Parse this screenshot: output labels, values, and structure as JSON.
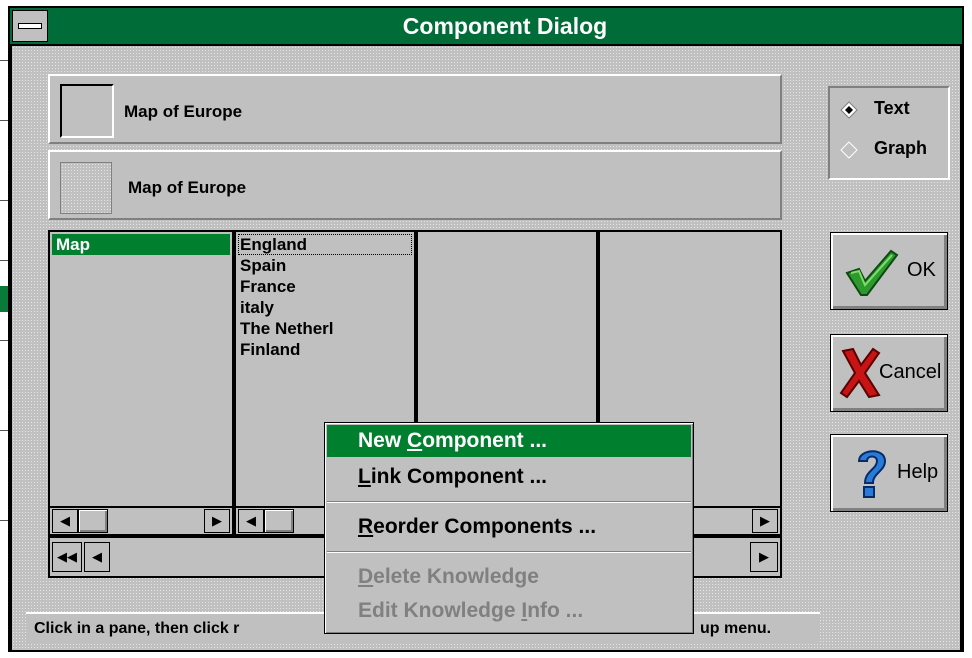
{
  "window": {
    "title": "Component Dialog"
  },
  "header_panels": [
    {
      "label": "Map of Europe"
    },
    {
      "label": "Map of Europe"
    }
  ],
  "view_options": [
    {
      "label": "Text",
      "selected": true
    },
    {
      "label": "Graph",
      "selected": false
    }
  ],
  "panes": {
    "pane1": {
      "items": [
        "Map"
      ],
      "selected": "Map"
    },
    "pane2": {
      "items": [
        "England",
        "Spain",
        "France",
        "italy",
        "The Netherl",
        "Finland"
      ],
      "focused": "England"
    }
  },
  "buttons": {
    "ok": "OK",
    "cancel": "Cancel",
    "help": "Help"
  },
  "context_menu": {
    "items": [
      {
        "before": "New ",
        "key": "C",
        "after": "omponent ...",
        "enabled": true,
        "highlighted": true
      },
      {
        "before": "",
        "key": "L",
        "after": "ink Component ...",
        "enabled": true,
        "highlighted": false
      },
      {
        "before": "",
        "key": "R",
        "after": "eorder Components ...",
        "enabled": true,
        "highlighted": false
      },
      {
        "before": "",
        "key": "D",
        "after": "elete Knowledge",
        "enabled": false,
        "highlighted": false
      },
      {
        "before": "Edit Knowledge ",
        "key": "I",
        "after": "nfo ...",
        "enabled": false,
        "highlighted": false
      }
    ]
  },
  "status": {
    "left_text": "Click in a pane, then click r",
    "right_text": "up menu."
  },
  "colors": {
    "title_bar": "#006c37",
    "selection": "#00802f",
    "face": "#c0c0c0"
  },
  "icons": [
    "system-menu-icon",
    "checkmark-icon",
    "x-cross-icon",
    "question-mark-icon",
    "arrow-left-icon",
    "arrow-right-icon",
    "double-arrow-left-icon"
  ]
}
